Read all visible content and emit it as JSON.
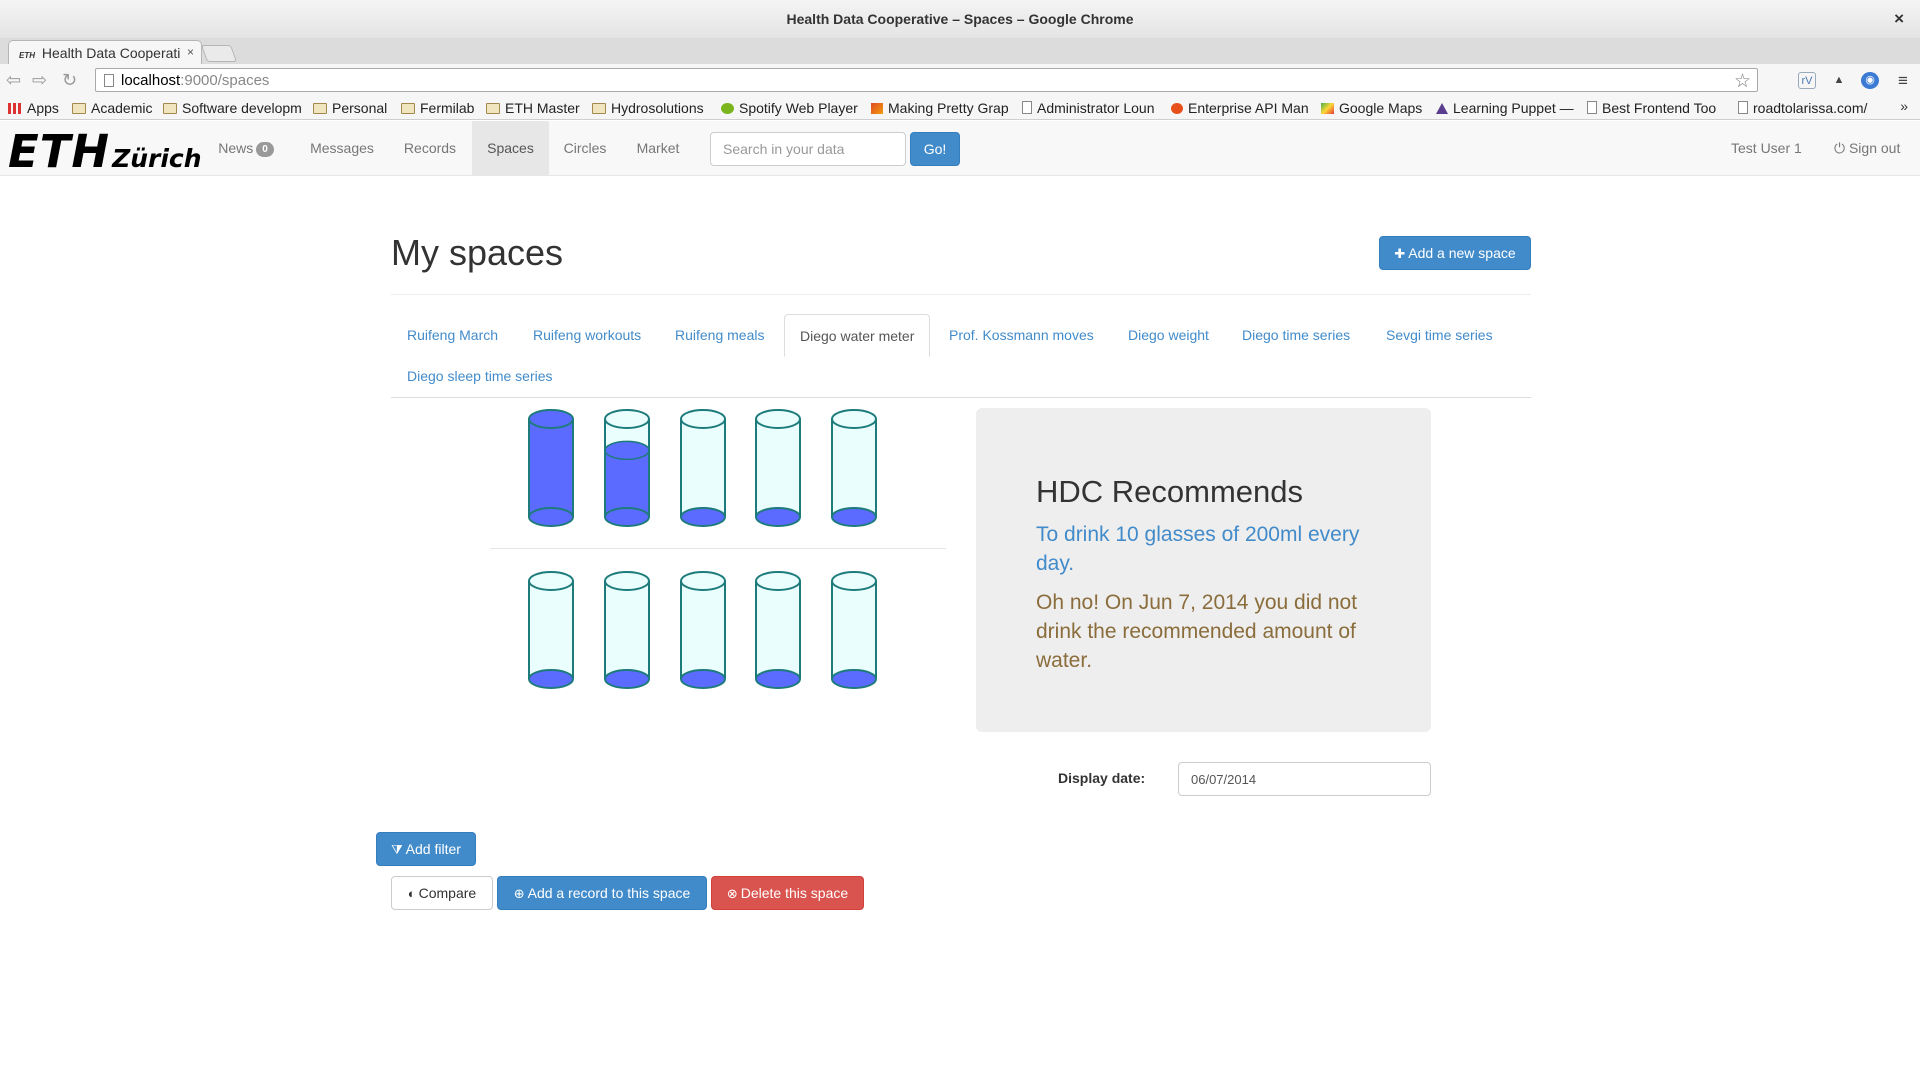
{
  "window": {
    "title": "Health Data Cooperative – Spaces – Google Chrome",
    "close_glyph": "×"
  },
  "browser": {
    "tab_label": "Health Data Cooperati",
    "tab_favicon": "ETH",
    "tab_close": "×",
    "url_host": "localhost",
    "url_path": ":9000/spaces",
    "bookmarks": [
      {
        "label": "Apps",
        "icon": "apps-grid-icon"
      },
      {
        "label": "Academic",
        "icon": "folder-icon"
      },
      {
        "label": "Software developm",
        "icon": "folder-icon"
      },
      {
        "label": "Personal",
        "icon": "folder-icon"
      },
      {
        "label": "Fermilab",
        "icon": "folder-icon"
      },
      {
        "label": "ETH Master",
        "icon": "folder-icon"
      },
      {
        "label": "Hydrosolutions",
        "icon": "folder-icon"
      },
      {
        "label": "Spotify Web Player",
        "icon": "spotify-icon"
      },
      {
        "label": "Making Pretty Grap",
        "icon": "matlab-icon"
      },
      {
        "label": "Administrator Loun",
        "icon": "page-icon"
      },
      {
        "label": "Enterprise API Man",
        "icon": "api-icon"
      },
      {
        "label": "Google Maps",
        "icon": "maps-icon"
      },
      {
        "label": "Learning Puppet —",
        "icon": "puppet-icon"
      },
      {
        "label": "Best Frontend Too",
        "icon": "page-icon"
      },
      {
        "label": "roadtolarissa.com/",
        "icon": "page-icon"
      }
    ],
    "bookmarks_more": "»"
  },
  "navbar": {
    "logo_main": "ETH",
    "logo_sub": "Zürich",
    "links": {
      "news": "News",
      "news_count": "0",
      "messages": "Messages",
      "records": "Records",
      "spaces": "Spaces",
      "circles": "Circles",
      "market": "Market"
    },
    "search_placeholder": "Search in your data",
    "go_label": "Go!",
    "user_name": "Test User 1",
    "sign_out": "Sign out"
  },
  "main": {
    "title": "My spaces",
    "add_space_label": "Add a new space",
    "space_tabs": [
      "Ruifeng March",
      "Ruifeng workouts",
      "Ruifeng meals",
      "Diego water meter",
      "Prof. Kossmann moves",
      "Diego weight",
      "Diego time series",
      "Sevgi time series",
      "Diego sleep time series"
    ],
    "active_tab": "Diego water meter"
  },
  "water_meter": {
    "glasses_fill": [
      1.0,
      0.68,
      0,
      0,
      0,
      0,
      0,
      0,
      0,
      0
    ],
    "fill_color": "#5b6bff",
    "glass_color": "#eafffd",
    "outline_color": "#1e7b7b"
  },
  "recommendation": {
    "title": "HDC Recommends",
    "advice": "To drink 10 glasses of 200ml every day.",
    "status": "Oh no! On Jun 7, 2014 you did not drink the recommended amount of water."
  },
  "date_picker": {
    "label": "Display date:",
    "value": "06/07/2014"
  },
  "actions": {
    "add_filter": "Add filter",
    "compare": "Compare",
    "add_record": "Add a record to this space",
    "delete_space": "Delete this space"
  },
  "colors": {
    "primary": "#428bca",
    "danger": "#d9534f",
    "warning_text": "#8a6d3b"
  }
}
